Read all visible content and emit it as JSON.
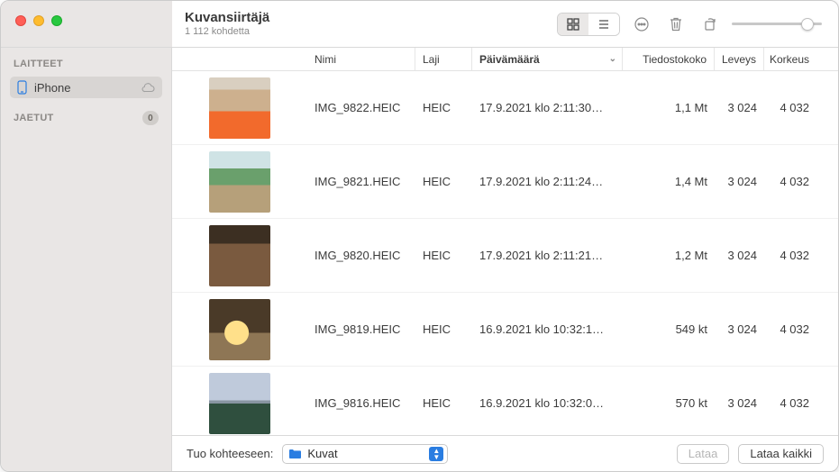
{
  "app_title": "Kuvansiirtäjä",
  "item_count_label": "1 112 kohdetta",
  "sidebar": {
    "devices_header": "LAITTEET",
    "shared_header": "JAETUT",
    "device_name": "iPhone",
    "shared_count": "0"
  },
  "columns": {
    "name": "Nimi",
    "type": "Laji",
    "date": "Päivämäärä",
    "size": "Tiedostokoko",
    "width": "Leveys",
    "height": "Korkeus"
  },
  "rows": [
    {
      "name": "IMG_9822.HEIC",
      "type": "HEIC",
      "date": "17.9.2021 klo 2:11:30…",
      "size": "1,1 Mt",
      "width": "3 024",
      "height": "4 032"
    },
    {
      "name": "IMG_9821.HEIC",
      "type": "HEIC",
      "date": "17.9.2021 klo 2:11:24…",
      "size": "1,4 Mt",
      "width": "3 024",
      "height": "4 032"
    },
    {
      "name": "IMG_9820.HEIC",
      "type": "HEIC",
      "date": "17.9.2021 klo 2:11:21…",
      "size": "1,2 Mt",
      "width": "3 024",
      "height": "4 032"
    },
    {
      "name": "IMG_9819.HEIC",
      "type": "HEIC",
      "date": "16.9.2021 klo 10:32:1…",
      "size": "549 kt",
      "width": "3 024",
      "height": "4 032"
    },
    {
      "name": "IMG_9816.HEIC",
      "type": "HEIC",
      "date": "16.9.2021 klo 10:32:0…",
      "size": "570 kt",
      "width": "3 024",
      "height": "4 032"
    }
  ],
  "bottom": {
    "import_to_label": "Tuo kohteeseen:",
    "destination": "Kuvat",
    "download_btn": "Lataa",
    "download_all_btn": "Lataa kaikki"
  },
  "thumbnail_slider_value": 90
}
